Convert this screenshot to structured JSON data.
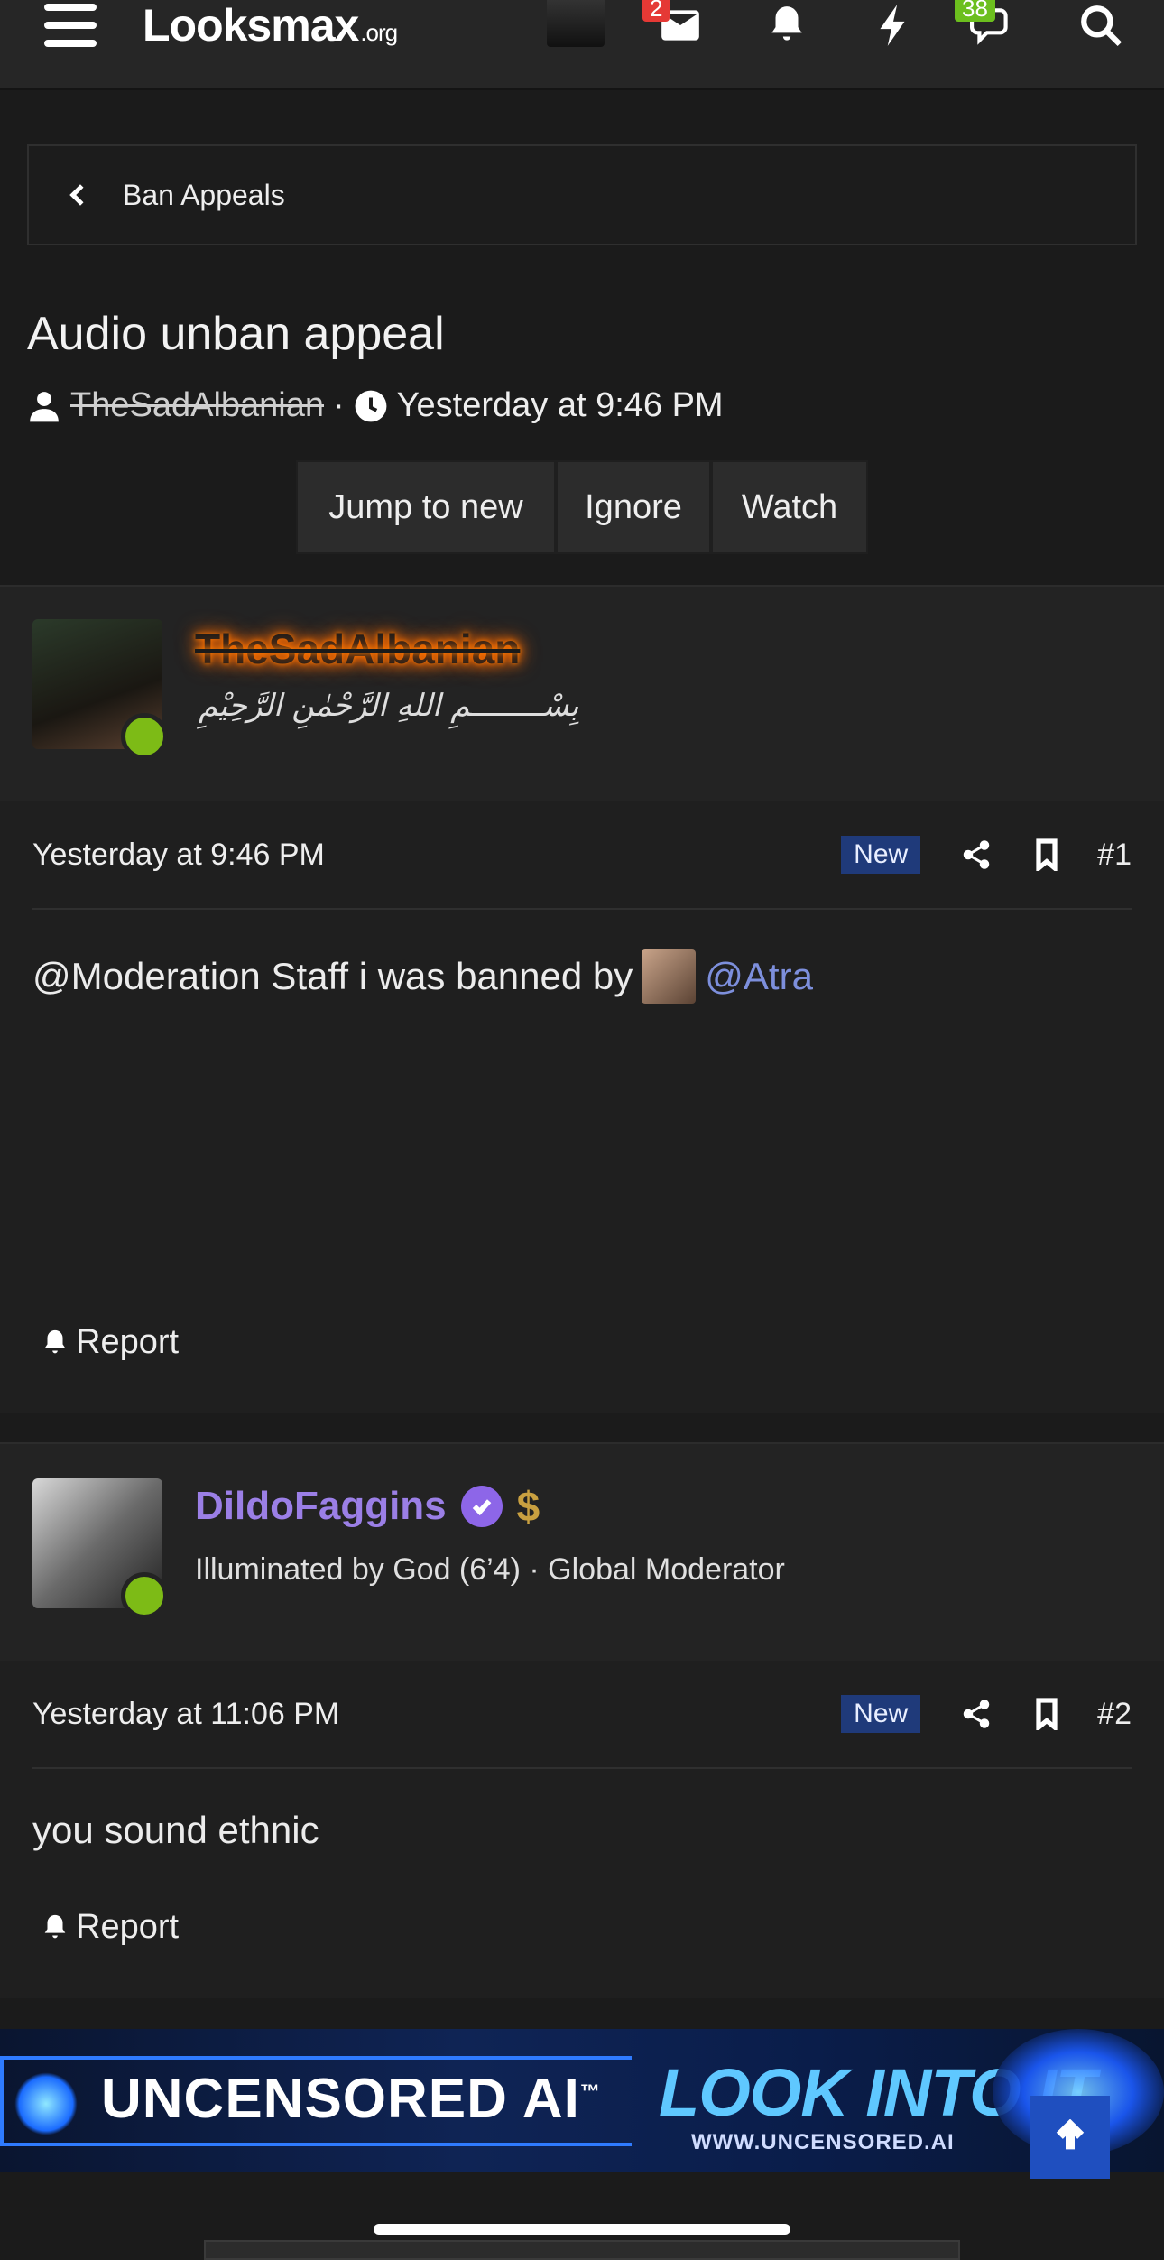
{
  "nav": {
    "logo_main": "Looksmax",
    "logo_suffix": ".org",
    "inbox_badge": "2",
    "chat_badge": "38"
  },
  "breadcrumb": {
    "label": "Ban Appeals"
  },
  "thread": {
    "title": "Audio unban appeal",
    "author": "TheSadAlbanian",
    "separator": "·",
    "date": "Yesterday at 9:46 PM"
  },
  "actions": {
    "jump": "Jump to new",
    "ignore": "Ignore",
    "watch": "Watch"
  },
  "posts": [
    {
      "username": "TheSadAlbanian",
      "signature": "بِسْــــــــمِ اللهِ الرَّحْمٰنِ الرَّحِيْمِ",
      "date": "Yesterday at 9:46 PM",
      "badge": "New",
      "number": "#1",
      "text": "@Moderation Staff i was banned by",
      "mention": "@Atra",
      "report": "Report"
    },
    {
      "username": "DildoFaggins",
      "money_glyph": "$",
      "title": "Illuminated by God (6’4) · Global Moderator",
      "date": "Yesterday at 11:06 PM",
      "badge": "New",
      "number": "#2",
      "text": "you sound ethnic",
      "report": "Report"
    }
  ],
  "ad": {
    "left_text": "UNCENSORED AI",
    "tm": "™",
    "right_text": "LOOK INTO IT",
    "url": "WWW.UNCENSORED.AI"
  },
  "colors": {
    "background": "#1b1b1b",
    "accent_blue": "#1f3a7a",
    "online_green": "#7dbb16",
    "moderator_purple": "#9b7fe6",
    "glow_orange": "#ff6a00"
  }
}
